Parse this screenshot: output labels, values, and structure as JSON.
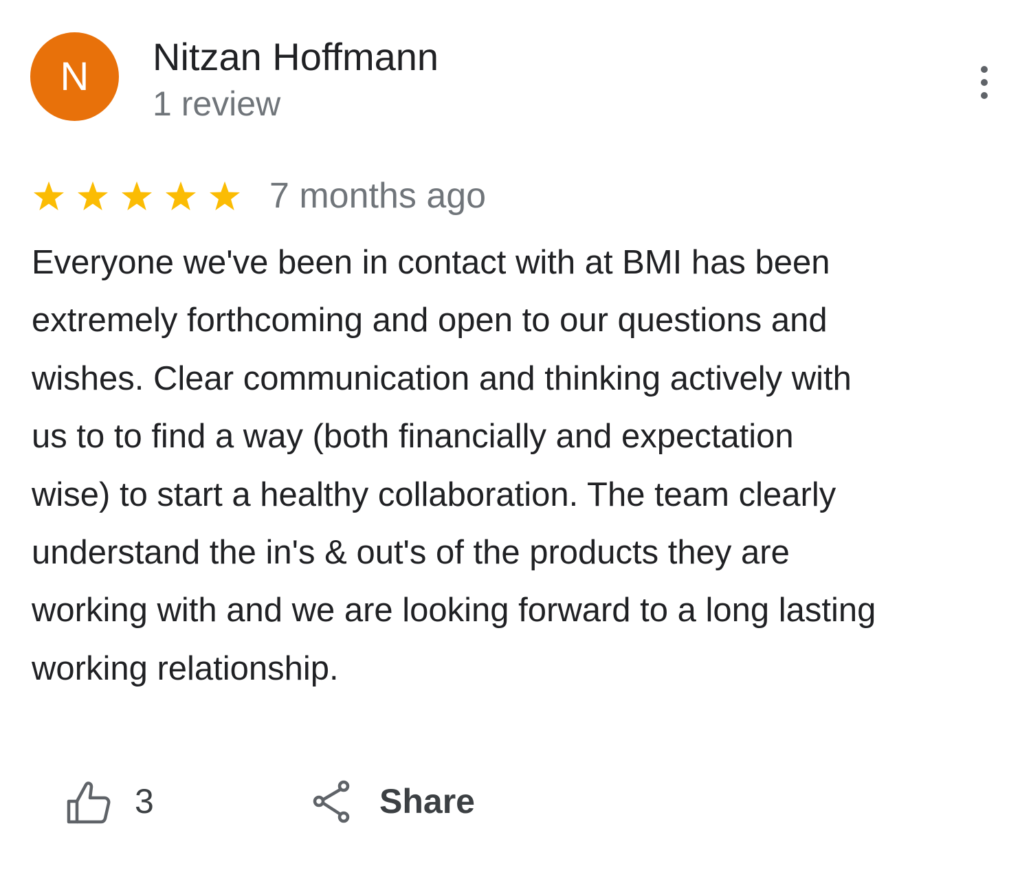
{
  "review": {
    "author": {
      "initial": "N",
      "name": "Nitzan Hoffmann",
      "review_count": "1 review",
      "avatar_color": "#e8710a"
    },
    "menu_icon": "more-vertical-icon",
    "rating": 5,
    "rating_max": 5,
    "star_color": "#fbbc04",
    "time_ago": "7 months ago",
    "text_lines": [
      "Everyone we've been in contact with at BMI has been",
      "extremely forthcoming and open to our questions and",
      "wishes. Clear communication and thinking actively with",
      "us to to find a way (both financially and expectation",
      "wise) to start a healthy collaboration. The team clearly",
      "understand the in's & out's of the products they are",
      "working with and we are looking forward to a long lasting",
      "working relationship."
    ],
    "actions": {
      "like_icon": "thumbs-up-icon",
      "like_count": "3",
      "share_icon": "share-icon",
      "share_label": "Share"
    }
  }
}
